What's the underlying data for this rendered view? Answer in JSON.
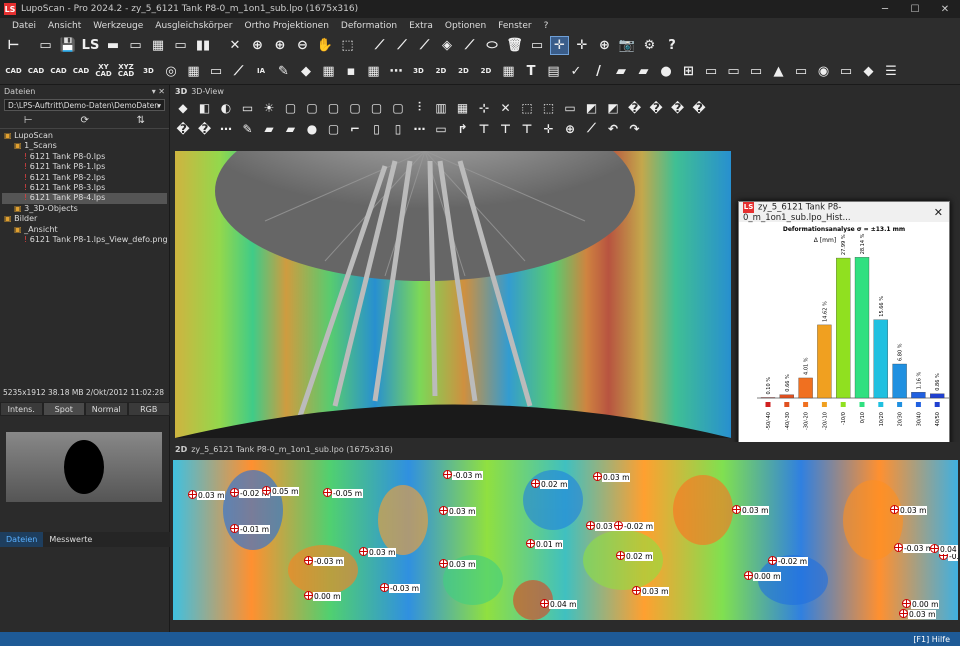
{
  "window": {
    "title": "LupoScan - Pro 2024.2 - zy_5_6121 Tank P8-0_m_1on1_sub.lpo (1675x316)",
    "logo": "LS"
  },
  "menu": [
    "Datei",
    "Ansicht",
    "Werkzeuge",
    "Ausgleichskörper",
    "Ortho Projektionen",
    "Deformation",
    "Extra",
    "Optionen",
    "Fenster",
    "?"
  ],
  "toolbar1": [
    "⊢",
    "▭",
    "💾",
    "LS",
    "▬",
    "▭",
    "▦",
    "▭",
    "▮▮",
    "✕",
    "⊕",
    "⊕",
    "⊖",
    "✋",
    "⬚",
    "⟋",
    "⟋",
    "⟋",
    "◈",
    "⟋",
    "⬭",
    "🗑",
    "▭",
    "✛",
    "✛",
    "⊕",
    "📷",
    "⚙",
    "?"
  ],
  "toolbar2": [
    {
      "t": "CAD"
    },
    {
      "t": "CAD"
    },
    {
      "t": "CAD"
    },
    {
      "t": "CAD"
    },
    {
      "t": "XY CAD"
    },
    {
      "t": "XYZ CAD"
    },
    {
      "t": "3D"
    },
    {
      "t": "◎"
    },
    {
      "t": "▦"
    },
    {
      "t": "▭"
    },
    {
      "t": "⟋"
    },
    {
      "t": "IA"
    },
    {
      "t": "✎"
    },
    {
      "t": "◆"
    },
    {
      "t": "▦"
    },
    {
      "t": "▪"
    },
    {
      "t": "▦"
    },
    {
      "t": "⋯"
    },
    {
      "t": "3D"
    },
    {
      "t": "2D"
    },
    {
      "t": "2D"
    },
    {
      "t": "2D"
    },
    {
      "t": "▦"
    },
    {
      "t": "T"
    },
    {
      "t": "▤"
    },
    {
      "t": "✓"
    },
    {
      "t": "/"
    },
    {
      "t": "▰"
    },
    {
      "t": "▰"
    },
    {
      "t": "●"
    },
    {
      "t": "⊞"
    },
    {
      "t": "▭"
    },
    {
      "t": "▭"
    },
    {
      "t": "▭"
    },
    {
      "t": "▲"
    },
    {
      "t": "▭"
    },
    {
      "t": "◉"
    },
    {
      "t": "▭"
    },
    {
      "t": "◆"
    },
    {
      "t": "☰"
    }
  ],
  "left": {
    "header": "Dateien",
    "path": "D:\\LPS-Auftritt\\Demo-Daten\\DemoDaten",
    "tree": [
      {
        "label": "LupoScan",
        "indent": 0
      },
      {
        "label": "1_Scans",
        "indent": 1
      },
      {
        "label": "6121 Tank P8-0.lps",
        "indent": 2
      },
      {
        "label": "6121 Tank P8-1.lps",
        "indent": 2
      },
      {
        "label": "6121 Tank P8-2.lps",
        "indent": 2
      },
      {
        "label": "6121 Tank P8-3.lps",
        "indent": 2
      },
      {
        "label": "6121 Tank P8-4.lps",
        "indent": 2,
        "sel": true
      },
      {
        "label": "3_3D-Objects",
        "indent": 1
      },
      {
        "label": "Bilder",
        "indent": 0
      },
      {
        "label": "_Ansicht",
        "indent": 1
      },
      {
        "label": "6121 Tank P8-1.lps_View_defo.png",
        "indent": 2
      }
    ],
    "info": "5235x1912  38.18 MB  2/Okt/2012  11:02:28",
    "modes": [
      "Intens.",
      "Spot",
      "Normal",
      "RGB"
    ],
    "tabs": [
      "Dateien",
      "Messwerte"
    ]
  },
  "view3d": {
    "tag": "3D",
    "title": "3D-View"
  },
  "view2d": {
    "tag": "2D",
    "title": "zy_5_6121 Tank P8-0_m_1on1_sub.lpo (1675x316)"
  },
  "hist": {
    "title": "zy_5_6121 Tank P8-0_m_1on1_sub.lpo_Hist...",
    "chart_title": "Deformationsanalyse  σ = ±13.1 mm",
    "ylabel": "Δ [mm]",
    "chart_data": {
      "type": "bar",
      "categories": [
        "-50/-40",
        "-40/-30",
        "-30/-20",
        "-20/-10",
        "-10/0",
        "0/10",
        "10/20",
        "20/30",
        "30/40",
        "40/50"
      ],
      "values": [
        0.1,
        0.66,
        4.01,
        14.62,
        27.99,
        28.14,
        15.66,
        6.8,
        1.16,
        0.86
      ],
      "labels": [
        "0.10 %",
        "0.66 %",
        "4.01 %",
        "14.62 %",
        "27.99 %",
        "28.14 %",
        "15.66 %",
        "6.80 %",
        "1.16 %",
        "0.86 %"
      ],
      "colors": [
        "#d02020",
        "#e05020",
        "#f07020",
        "#f0a020",
        "#90e020",
        "#30e080",
        "#20c0e0",
        "#2090e0",
        "#2060e0",
        "#2040d0"
      ],
      "ylim": [
        0,
        30
      ]
    }
  },
  "labels2d": [
    {
      "v": "0.03 m"
    },
    {
      "v": "-0.02 m"
    },
    {
      "v": "0.05 m"
    },
    {
      "v": "-0.05 m"
    },
    {
      "v": "-0.03 m"
    },
    {
      "v": "0.02 m"
    },
    {
      "v": "0.03 m"
    },
    {
      "v": "0.03 m"
    },
    {
      "v": "0.03 m"
    },
    {
      "v": "0.03 m"
    },
    {
      "v": "-0.01 m"
    },
    {
      "v": "0.03 m"
    },
    {
      "v": "-0.03 m"
    },
    {
      "v": "0.03 m"
    },
    {
      "v": "0.03 m"
    },
    {
      "v": "-0.02 m"
    },
    {
      "v": "0.01 m"
    },
    {
      "v": "0.02 m"
    },
    {
      "v": "0.04 m"
    },
    {
      "v": "-0.03 m"
    },
    {
      "v": "-0.02 m"
    },
    {
      "v": "-0.03 m"
    },
    {
      "v": "0.00 m"
    },
    {
      "v": "0.00 m"
    },
    {
      "v": "-0.03 m"
    },
    {
      "v": "0.03 m"
    },
    {
      "v": "0.04 m"
    },
    {
      "v": "0.03 m"
    },
    {
      "v": "0.00 m"
    }
  ],
  "status": "[F1] Hilfe"
}
